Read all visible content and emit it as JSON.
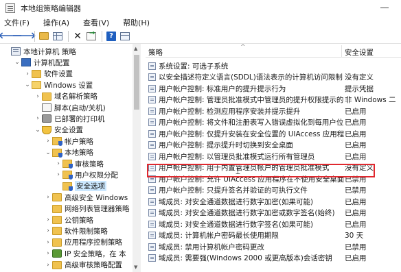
{
  "window": {
    "title": "本地组策略编辑器"
  },
  "menu": [
    "文件(F)",
    "操作(A)",
    "查看(V)",
    "帮助(H)"
  ],
  "toolbar": {
    "icons": [
      "back-arrow-icon",
      "forward-arrow-icon",
      "folder-up-icon",
      "show-hide-tree-icon",
      "delete-icon",
      "export-list-icon",
      "help-icon",
      "view-icon"
    ]
  },
  "tree": [
    {
      "label": "本地计算机 策略",
      "indent": 0,
      "chev": "",
      "icon": "policy"
    },
    {
      "label": "计算机配置",
      "indent": 1,
      "chev": "v",
      "icon": "pc"
    },
    {
      "label": "软件设置",
      "indent": 2,
      "chev": ">",
      "icon": "folder"
    },
    {
      "label": "Windows 设置",
      "indent": 2,
      "chev": "v",
      "icon": "folder-open"
    },
    {
      "label": "域名解析策略",
      "indent": 3,
      "chev": ">",
      "icon": "folder"
    },
    {
      "label": "脚本(启动/关机)",
      "indent": 3,
      "chev": "",
      "icon": "script"
    },
    {
      "label": "已部署的打印机",
      "indent": 3,
      "chev": ">",
      "icon": "printer"
    },
    {
      "label": "安全设置",
      "indent": 3,
      "chev": "v",
      "icon": "shield"
    },
    {
      "label": "帐户策略",
      "indent": 4,
      "chev": ">",
      "icon": "shield-folder"
    },
    {
      "label": "本地策略",
      "indent": 4,
      "chev": "v",
      "icon": "shield-folder"
    },
    {
      "label": "审核策略",
      "indent": 5,
      "chev": ">",
      "icon": "shield-folder"
    },
    {
      "label": "用户权限分配",
      "indent": 5,
      "chev": ">",
      "icon": "shield-folder"
    },
    {
      "label": "安全选项",
      "indent": 5,
      "chev": "",
      "icon": "shield-folder",
      "selected": true
    },
    {
      "label": "高级安全 Windows",
      "indent": 4,
      "chev": ">",
      "icon": "folder"
    },
    {
      "label": "网络列表管理器策略",
      "indent": 4,
      "chev": "",
      "icon": "folder"
    },
    {
      "label": "公钥策略",
      "indent": 4,
      "chev": ">",
      "icon": "folder"
    },
    {
      "label": "软件限制策略",
      "indent": 4,
      "chev": ">",
      "icon": "folder"
    },
    {
      "label": "应用程序控制策略",
      "indent": 4,
      "chev": ">",
      "icon": "folder"
    },
    {
      "label": "IP 安全策略，在 本",
      "indent": 4,
      "chev": ">",
      "icon": "ipsec"
    },
    {
      "label": "高级审核策略配置",
      "indent": 4,
      "chev": ">",
      "icon": "folder"
    }
  ],
  "columns": {
    "policy": "策略",
    "setting": "安全设置"
  },
  "policies": [
    {
      "name": "系统设置: 可选子系统",
      "value": ""
    },
    {
      "name": "以安全描述符定义语言(SDDL)语法表示的计算机访问限制",
      "value": "没有定义"
    },
    {
      "name": "用户帐户控制: 标准用户的提升提示行为",
      "value": "提示凭据"
    },
    {
      "name": "用户帐户控制: 管理员批准模式中管理员的提升权限提示的...",
      "value": "非 Windows 二"
    },
    {
      "name": "用户帐户控制: 检测应用程序安装并提示提升",
      "value": "已启用"
    },
    {
      "name": "用户帐户控制: 将文件和注册表写入错误虚拟化到每用户位置",
      "value": "已启用"
    },
    {
      "name": "用户帐户控制: 仅提升安装在安全位置的 UIAccess 应用程序",
      "value": "已启用"
    },
    {
      "name": "用户帐户控制: 提示提升时切换到安全桌面",
      "value": "已启用"
    },
    {
      "name": "用户帐户控制: 以管理员批准模式运行所有管理员",
      "value": "已启用"
    },
    {
      "name": "用户帐户控制: 用于内置管理员帐户的管理员批准模式",
      "value": "没有定义"
    },
    {
      "name": "用户帐户控制: 允许 UIAccess 应用程序在不使用安全桌面...",
      "value": "已禁用"
    },
    {
      "name": "用户帐户控制: 只提升签名并验证的可执行文件",
      "value": "已禁用"
    },
    {
      "name": "域成员: 对安全通道数据进行数字加密(如果可能)",
      "value": "已启用"
    },
    {
      "name": "域成员: 对安全通道数据进行数字加密或数字签名(始终)",
      "value": "已启用"
    },
    {
      "name": "域成员: 对安全通道数据进行数字签名(如果可能)",
      "value": "已启用"
    },
    {
      "name": "域成员: 计算机帐户密码最长使用期限",
      "value": "30 天"
    },
    {
      "name": "域成员: 禁用计算机帐户密码更改",
      "value": "已禁用"
    },
    {
      "name": "域成员: 需要强(Windows 2000 或更高版本)会话密钥",
      "value": "已启用"
    }
  ],
  "highlighted_policy_index": 9,
  "colors": {
    "highlight_border": "#e0282e",
    "selection": "#cce8ff"
  }
}
